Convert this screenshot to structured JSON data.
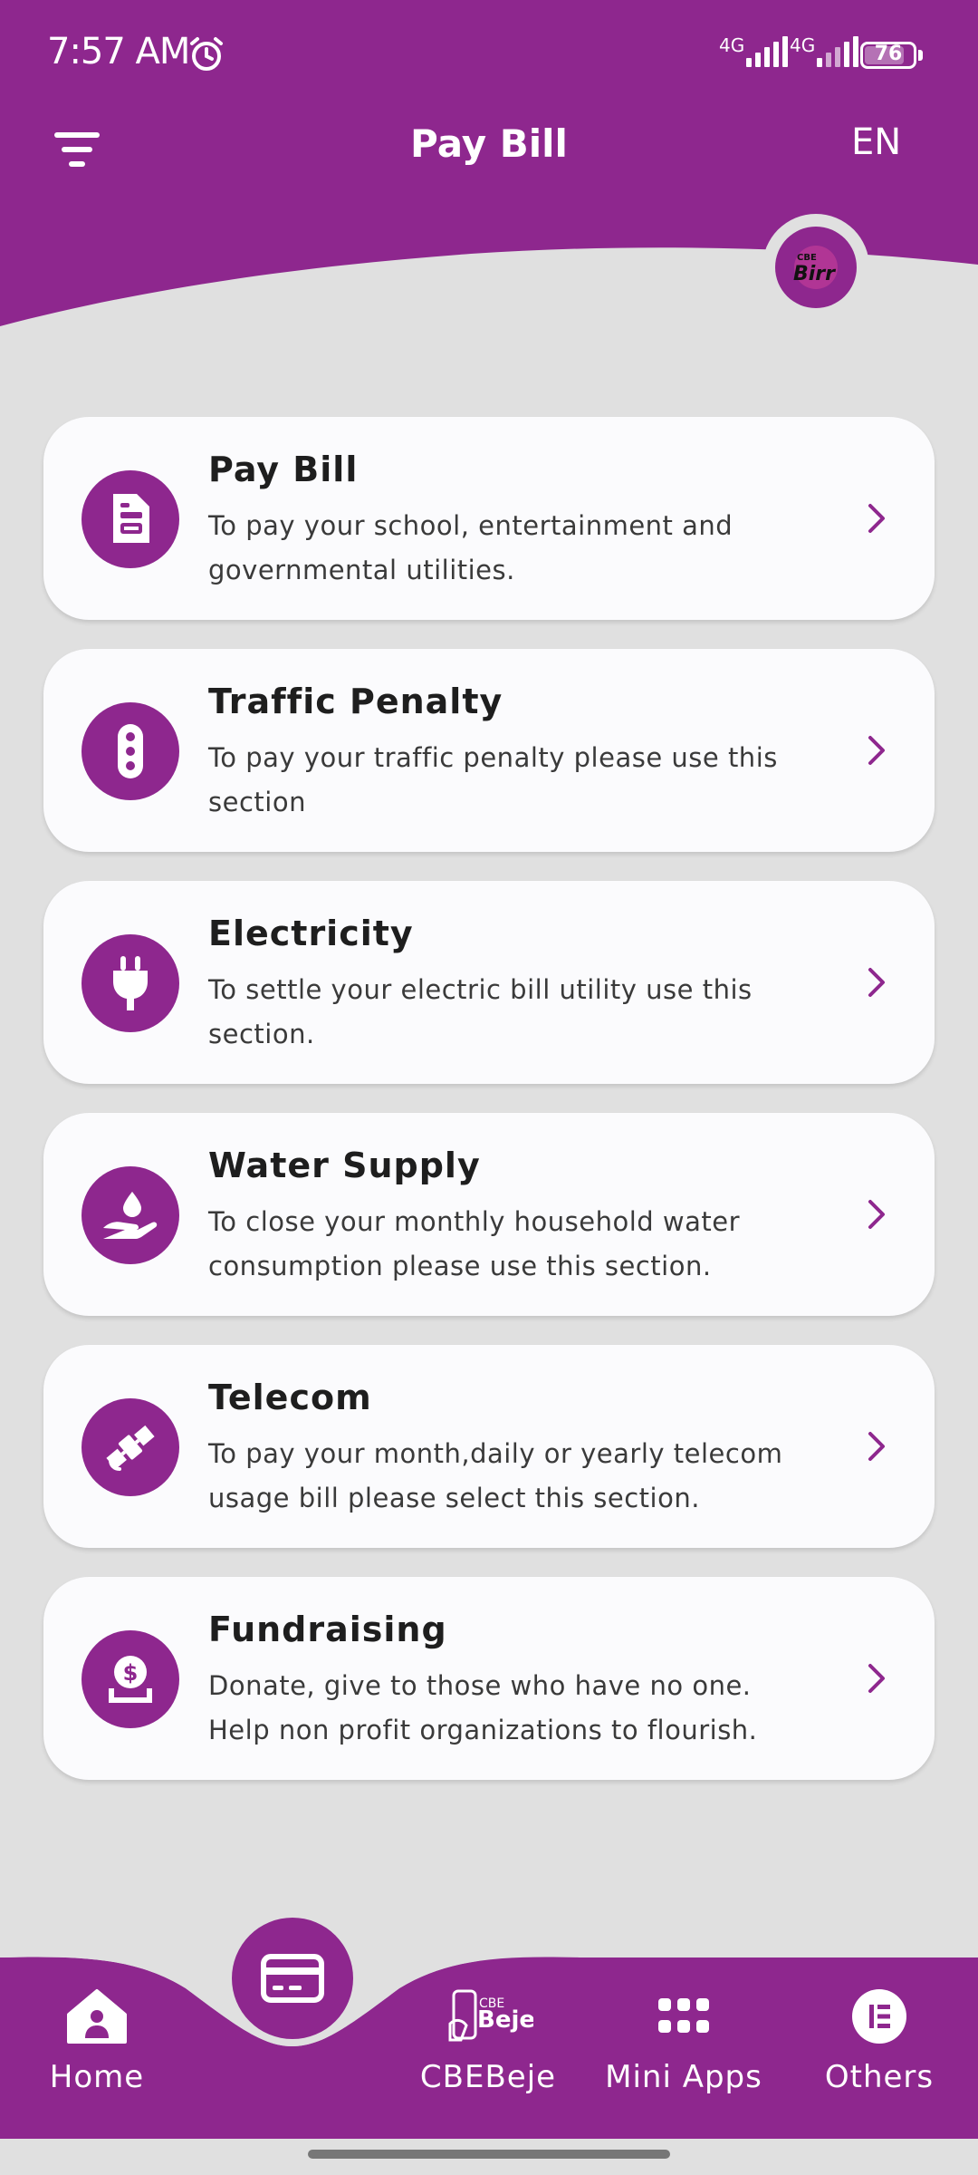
{
  "status_bar": {
    "time": "7:57 AM",
    "network_1": "4G",
    "network_2": "4G",
    "battery": "76"
  },
  "header": {
    "title": "Pay Bill",
    "language": "EN",
    "logo_small": "CBE",
    "logo_text": "Birr"
  },
  "cards": [
    {
      "title": "Pay Bill",
      "description": "To pay your school, entertainment and governmental utilities.",
      "icon": "document-icon"
    },
    {
      "title": "Traffic Penalty",
      "description": "To pay your traffic penalty please use this section",
      "icon": "traffic-light-icon"
    },
    {
      "title": "Electricity",
      "description": "To settle your electric bill utility use this section.",
      "icon": "plug-icon"
    },
    {
      "title": "Water Supply",
      "description": "To close your monthly household water consumption please use this section.",
      "icon": "water-hand-icon"
    },
    {
      "title": "Telecom",
      "description": "To pay your month,daily or yearly telecom usage bill please select this section.",
      "icon": "satellite-icon"
    },
    {
      "title": "Fundraising",
      "description": "Donate, give to those who have no one. Help non profit organizations to flourish.",
      "icon": "donate-icon"
    }
  ],
  "bottom_nav": {
    "home": "Home",
    "cbebeje": "CBEBeje",
    "cbebeje_logo_small": "CBE",
    "cbebeje_logo_text": "Beje",
    "mini_apps": "Mini Apps",
    "others": "Others"
  },
  "colors": {
    "primary": "#8e278e",
    "background": "#e0e0e0",
    "card": "#fbfbfd"
  }
}
